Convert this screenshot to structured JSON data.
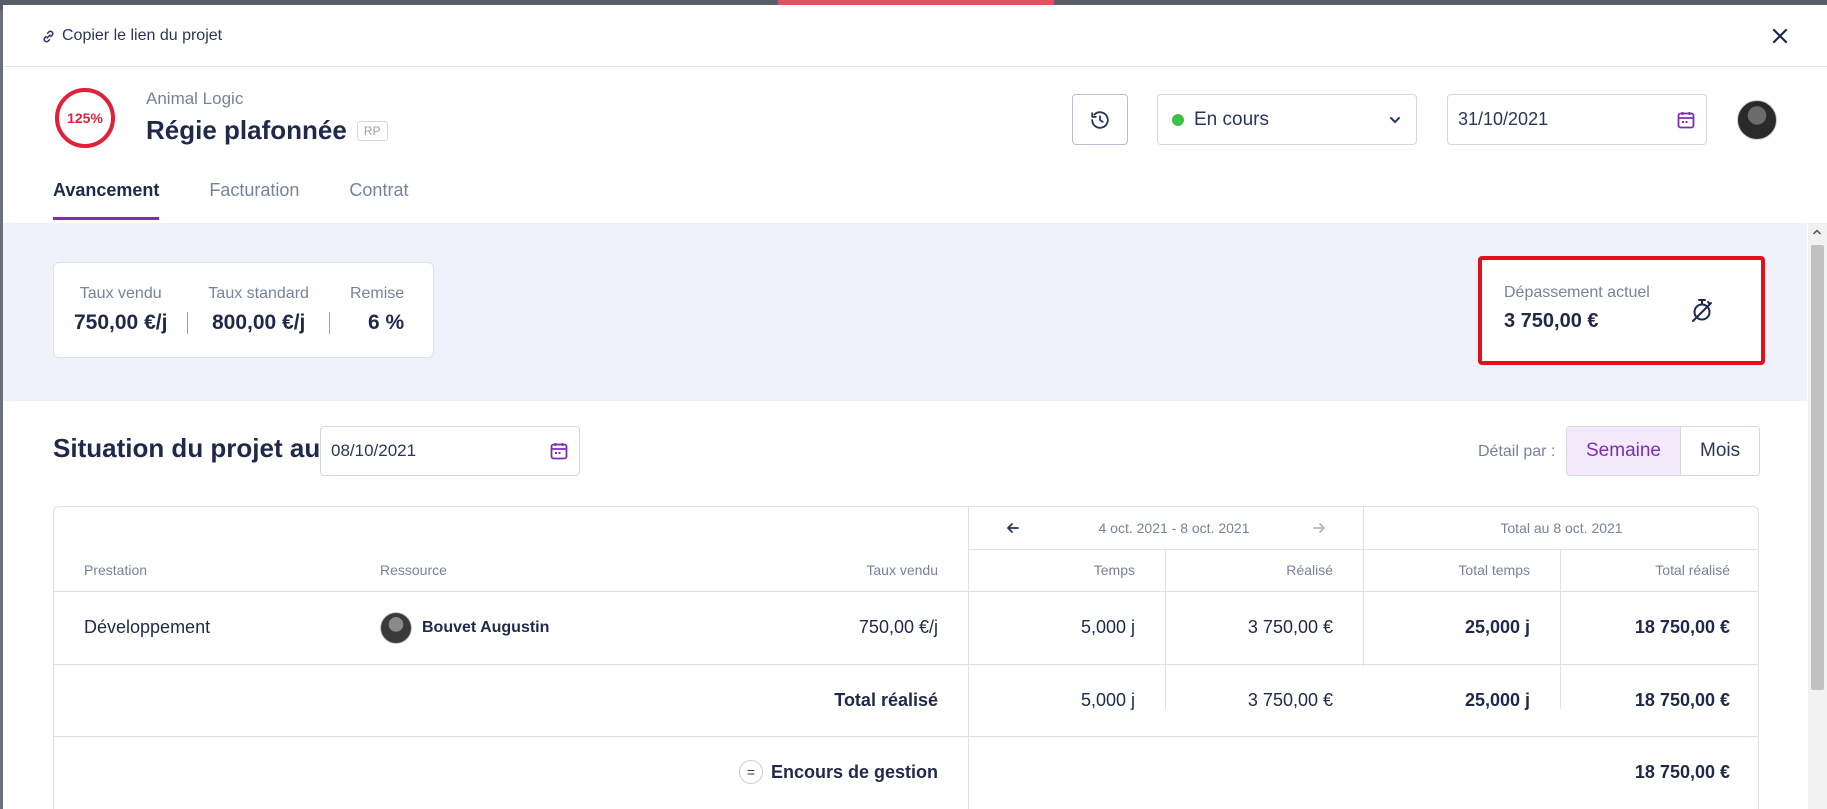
{
  "modal": {
    "copy_link_label": "Copier le lien du projet"
  },
  "project": {
    "progress_label": "125%",
    "progress_value": 1.25,
    "client": "Animal Logic",
    "title": "Régie plafonnée",
    "badge": "RP",
    "status": "En cours",
    "end_date": "31/10/2021",
    "status_color": "#3ac24a"
  },
  "tabs": [
    {
      "label": "Avancement",
      "active": true
    },
    {
      "label": "Facturation",
      "active": false
    },
    {
      "label": "Contrat",
      "active": false
    }
  ],
  "rates": [
    {
      "label": "Taux vendu",
      "value": "750,00 €/j"
    },
    {
      "label": "Taux standard",
      "value": "800,00 €/j"
    },
    {
      "label": "Remise",
      "value": "6 %"
    }
  ],
  "overrun": {
    "label": "Dépassement actuel",
    "value": "3 750,00 €",
    "highlight_color": "#e0111c"
  },
  "situation": {
    "title": "Situation du projet au",
    "date": "08/10/2021",
    "detail_label": "Détail par :",
    "toggle": [
      {
        "label": "Semaine",
        "active": true
      },
      {
        "label": "Mois",
        "active": false
      }
    ]
  },
  "table": {
    "period_label": "4 oct. 2021 - 8 oct. 2021",
    "total_label": "Total au 8 oct. 2021",
    "headers": {
      "prestation": "Prestation",
      "ressource": "Ressource",
      "taux": "Taux vendu",
      "temps": "Temps",
      "realise": "Réalisé",
      "total_temps": "Total temps",
      "total_realise": "Total réalisé"
    },
    "rows": [
      {
        "prestation": "Développement",
        "ressource": "Bouvet Augustin",
        "taux": "750,00 €/j",
        "temps": "5,000 j",
        "realise": "3 750,00 €",
        "total_temps": "25,000 j",
        "total_realise": "18 750,00 €"
      }
    ],
    "total_row": {
      "label": "Total réalisé",
      "temps": "5,000 j",
      "realise": "3 750,00 €",
      "total_temps": "25,000 j",
      "total_realise": "18 750,00 €"
    },
    "encours_row": {
      "icon": "=",
      "label": "Encours de gestion",
      "total_realise": "18 750,00 €"
    }
  },
  "colors": {
    "accent": "#7a2fb0",
    "progress_ring": "#e0213a"
  }
}
